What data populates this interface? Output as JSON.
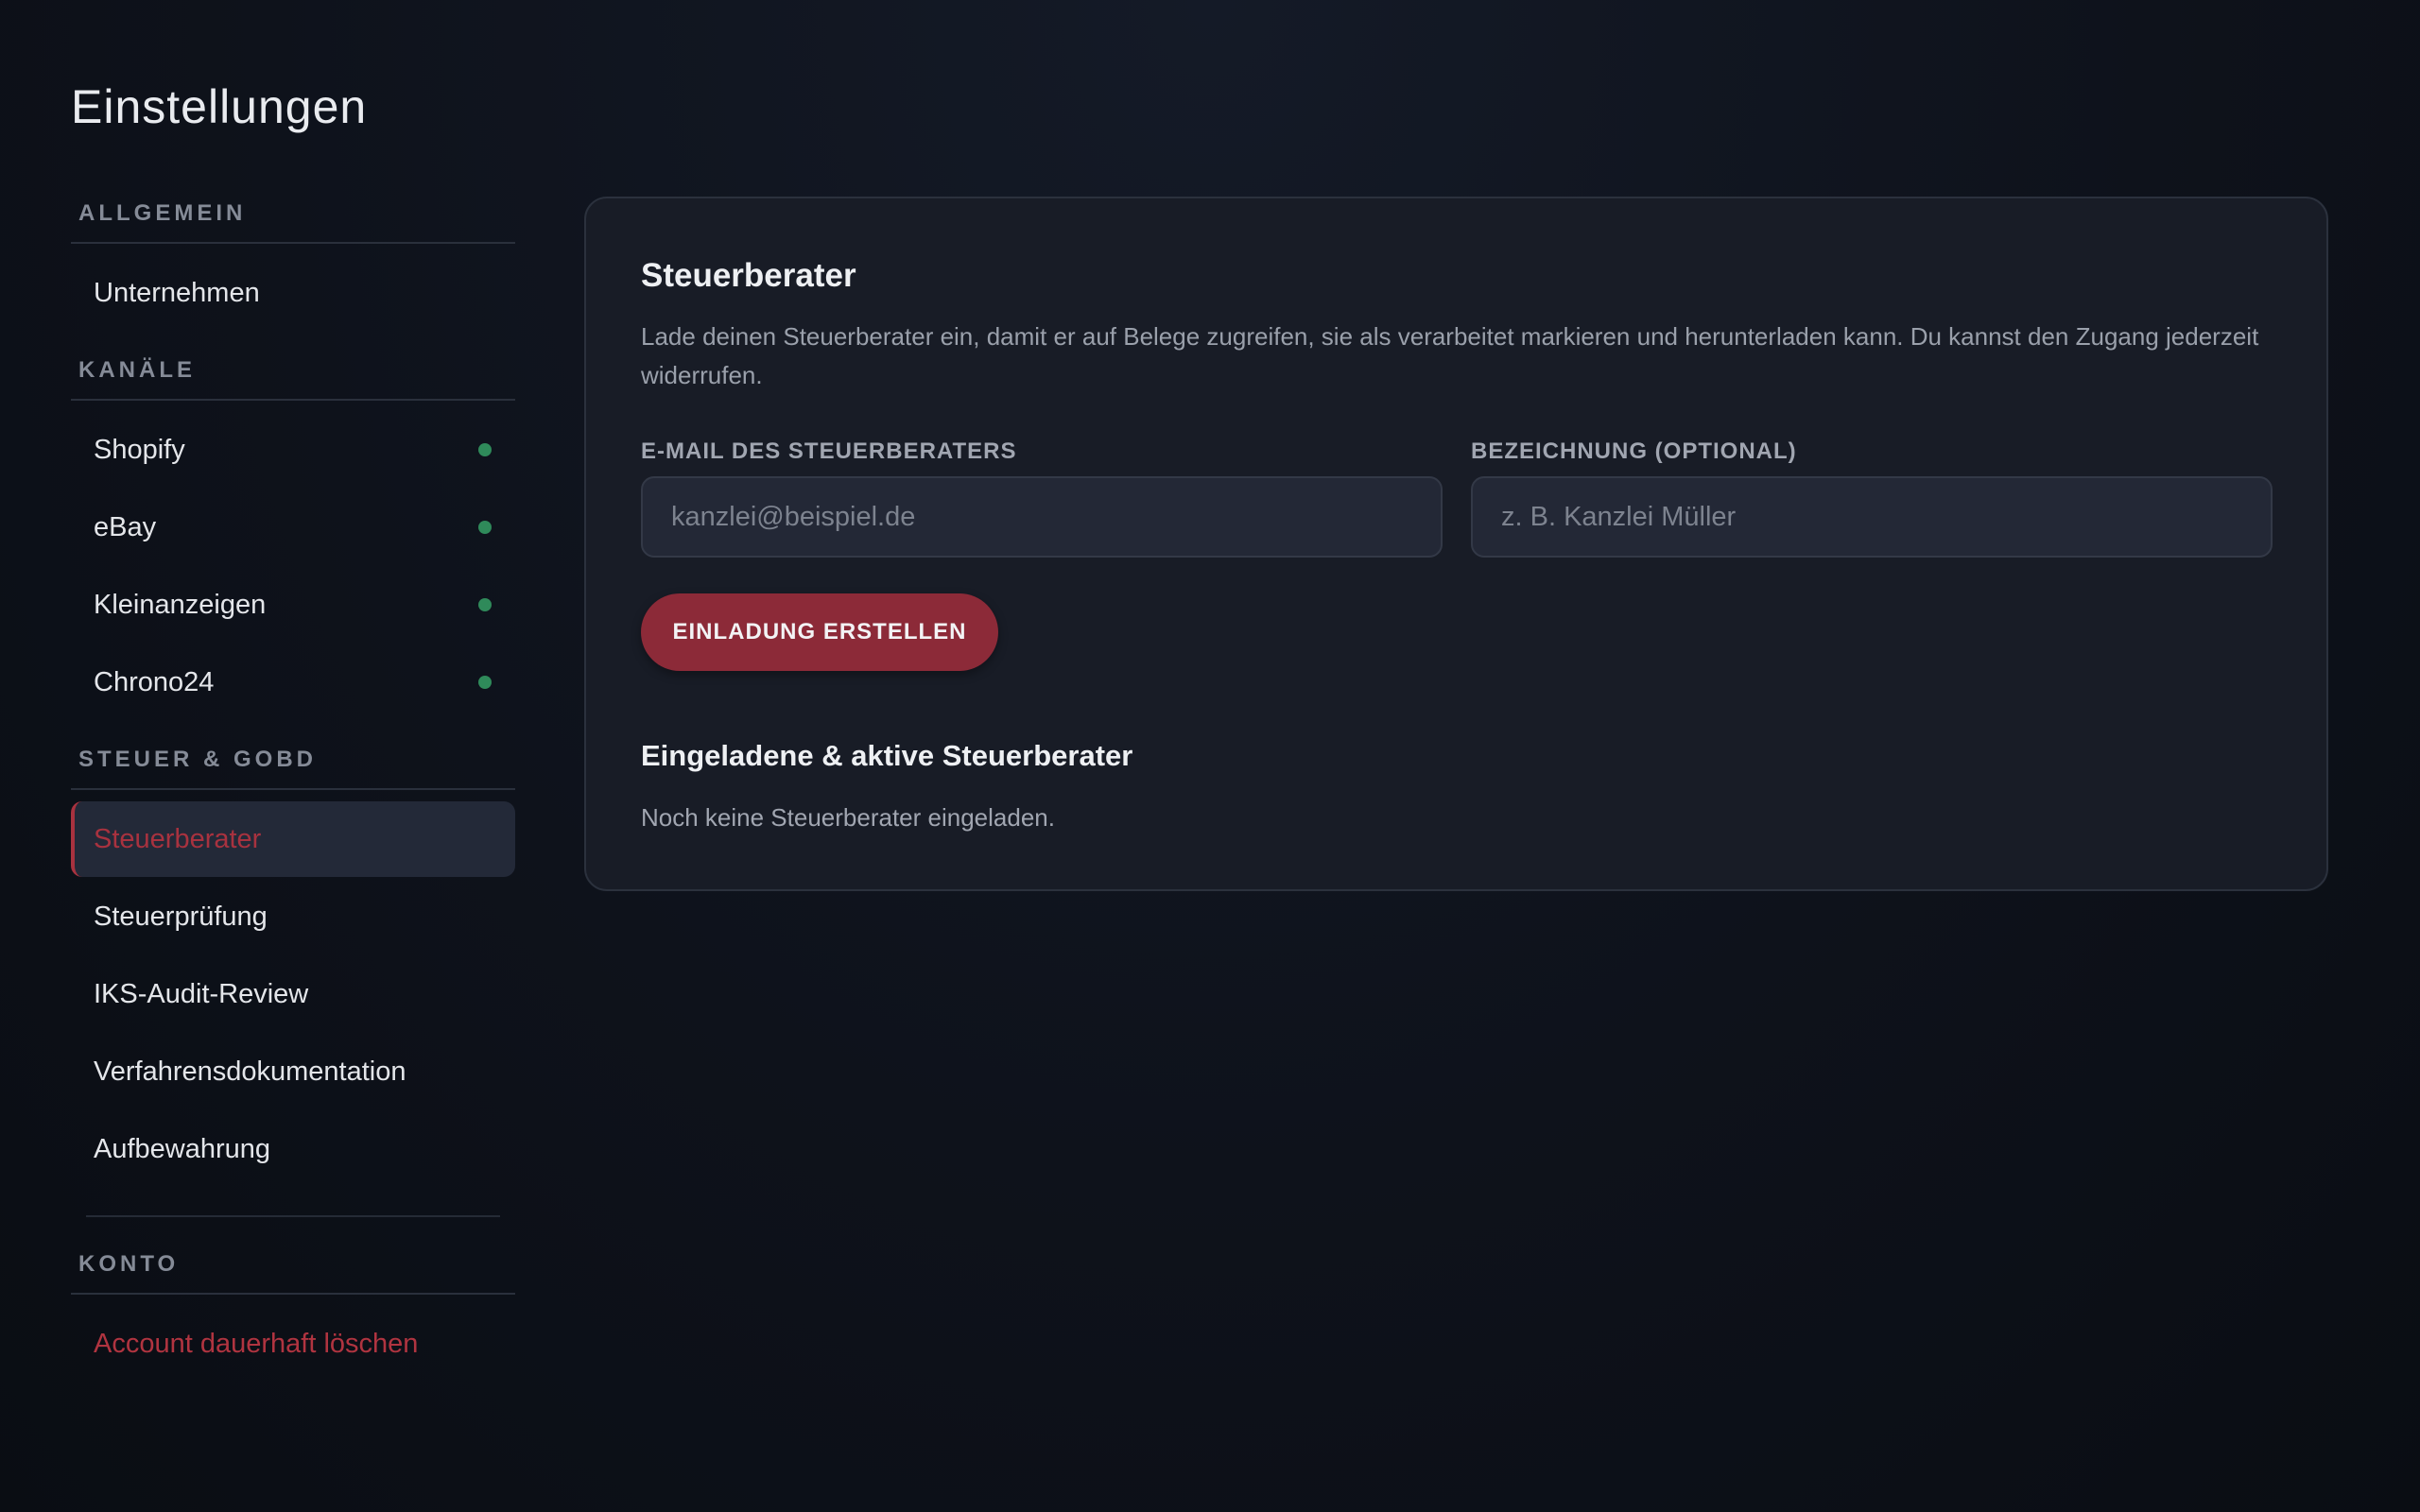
{
  "page": {
    "title": "Einstellungen"
  },
  "sidebar": {
    "sections": [
      {
        "heading": "ALLGEMEIN",
        "items": [
          {
            "label": "Unternehmen"
          }
        ]
      },
      {
        "heading": "KANÄLE",
        "items": [
          {
            "label": "Shopify",
            "status": "connected"
          },
          {
            "label": "eBay",
            "status": "connected"
          },
          {
            "label": "Kleinanzeigen",
            "status": "connected"
          },
          {
            "label": "Chrono24",
            "status": "connected"
          }
        ]
      },
      {
        "heading": "STEUER & GOBD",
        "items": [
          {
            "label": "Steuerberater",
            "active": true
          },
          {
            "label": "Steuerprüfung"
          },
          {
            "label": "IKS-Audit-Review"
          },
          {
            "label": "Verfahrensdokumentation"
          },
          {
            "label": "Aufbewahrung"
          }
        ]
      },
      {
        "heading": "KONTO",
        "items": [
          {
            "label": "Account dauerhaft löschen",
            "danger": true
          }
        ]
      }
    ]
  },
  "main": {
    "title": "Steuerberater",
    "description": "Lade deinen Steuerberater ein, damit er auf Belege zugreifen, sie als verarbeitet markieren und herunterladen kann. Du kannst den Zugang jederzeit widerrufen.",
    "email": {
      "label": "E-MAIL DES STEUERBERATERS",
      "placeholder": "kanzlei@beispiel.de",
      "value": ""
    },
    "name": {
      "label": "BEZEICHNUNG (OPTIONAL)",
      "placeholder": "z. B. Kanzlei Müller",
      "value": ""
    },
    "submit_label": "EINLADUNG ERSTELLEN",
    "list_title": "Eingeladene & aktive Steuerberater",
    "empty_text": "Noch keine Steuerberater eingeladen."
  },
  "colors": {
    "accent": "#8c2a38",
    "active_text": "#a8323f",
    "status_dot": "#2f8a5a",
    "background": "#0e121b",
    "card": "#181c26"
  }
}
